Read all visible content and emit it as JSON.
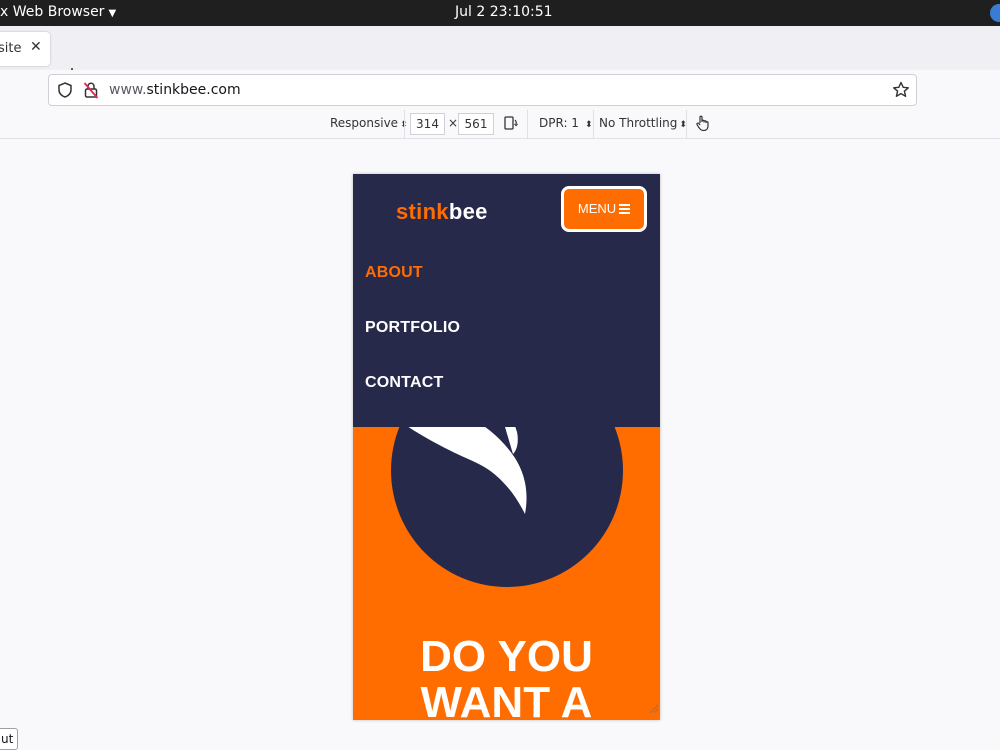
{
  "system_bar": {
    "app_name": "x Web Browser",
    "caret_icon": "caret-down-icon",
    "clock": "Jul 2  23:10:51",
    "tray_icon": "accessibility-icon"
  },
  "tabs": {
    "items": [
      {
        "label": "site",
        "close_icon": "close-icon"
      }
    ],
    "new_tab_icon": "plus-icon"
  },
  "address_bar": {
    "url_prefix": "www.",
    "url_domain": "stinkbee.com",
    "icons": [
      "shield-icon",
      "insecure-lock-icon",
      "star-icon"
    ]
  },
  "rdm_toolbar": {
    "device": "Responsive",
    "width": "314",
    "times": "×",
    "height": "561",
    "rotate_icon": "rotate-device-icon",
    "dpr": "DPR: 1",
    "throttling": "No Throttling",
    "touch_icon": "touch-simulation-icon",
    "arrows": "⬍"
  },
  "page": {
    "logo": {
      "part1": "stink",
      "part2": "bee"
    },
    "menu_button": "MENU",
    "nav_links": [
      "ABOUT",
      "PORTFOLIO",
      "CONTACT"
    ],
    "headline": [
      "DO YOU",
      "WANT A"
    ],
    "colors": {
      "navy": "#26294a",
      "orange": "#ff6c00",
      "white": "#ffffff"
    }
  },
  "tooltip": "ut"
}
